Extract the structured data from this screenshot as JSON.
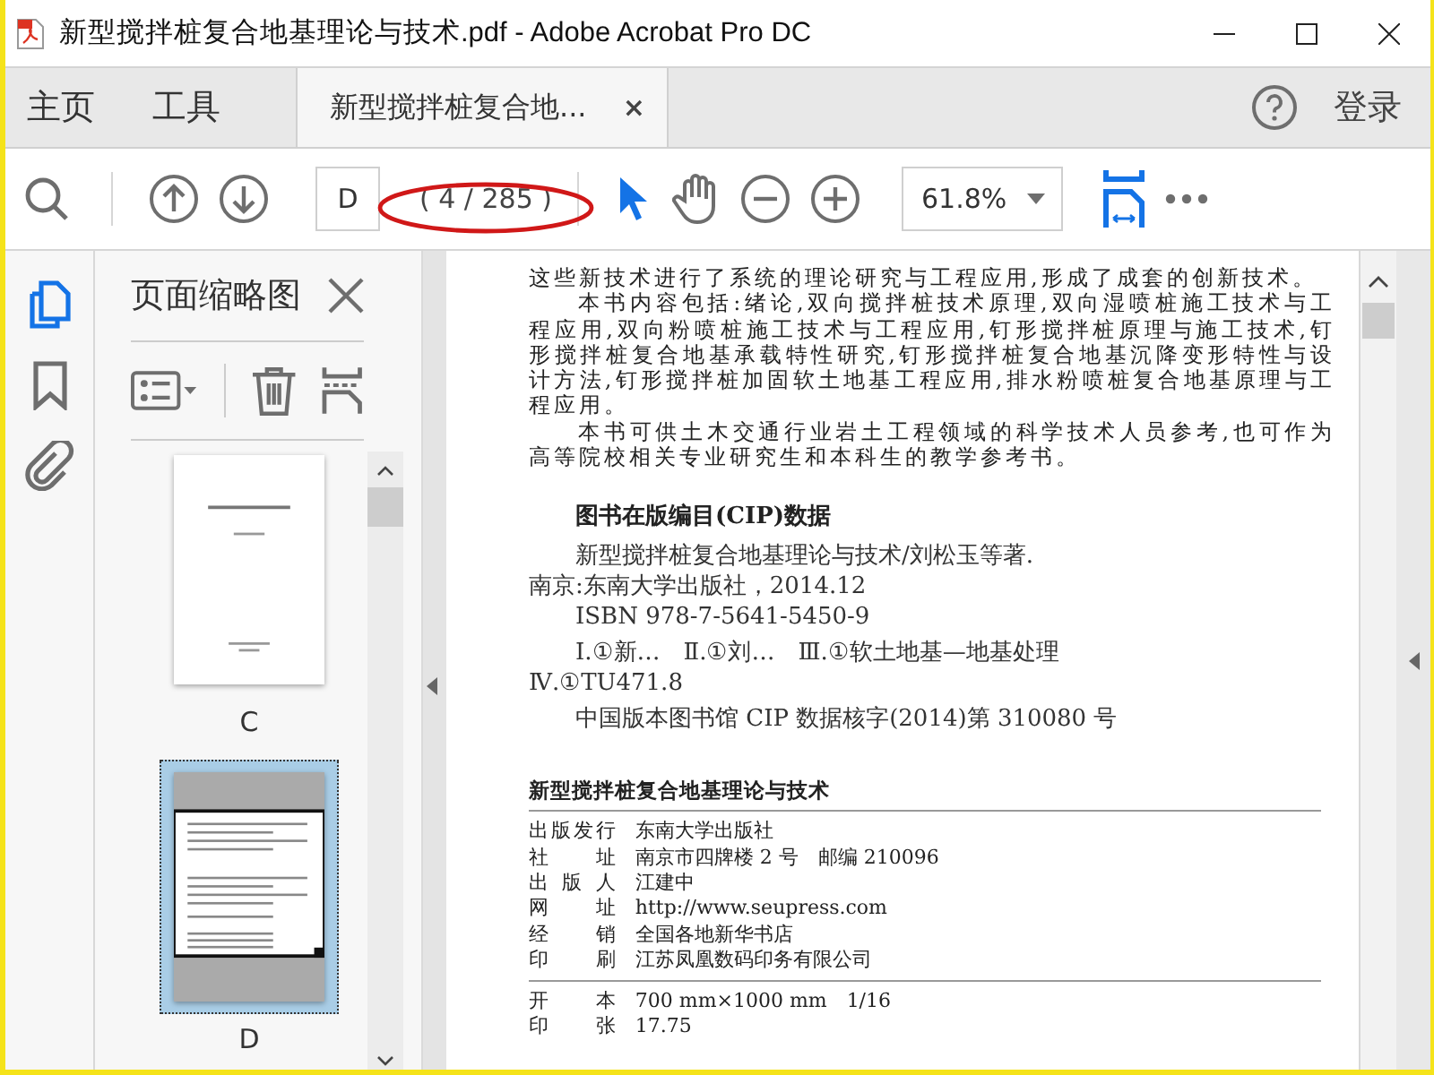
{
  "window": {
    "title": "新型搅拌桩复合地基理论与技术.pdf - Adobe Acrobat Pro DC"
  },
  "nav_tabs": [
    {
      "label": "主页",
      "selected": false
    },
    {
      "label": "工具",
      "selected": false
    }
  ],
  "document_tab": {
    "label": "新型搅拌桩复合地...",
    "close": "×",
    "selected": true
  },
  "sign_in": "登录",
  "toolbar": {
    "page_label": "D",
    "page_count": "( 4 / 285 )",
    "zoom": "61.8%",
    "tools": [
      {
        "kind": "select",
        "selected": true
      },
      {
        "kind": "hand",
        "selected": false
      }
    ]
  },
  "side_panels": [
    {
      "kind": "pages",
      "selected": true
    },
    {
      "kind": "bookmarks",
      "selected": false
    },
    {
      "kind": "attachments",
      "selected": false
    }
  ],
  "thumbnail_panel": {
    "title": "页面缩略图"
  },
  "thumbnails": [
    {
      "label": "C",
      "selected": false
    },
    {
      "label": "D",
      "selected": true
    }
  ],
  "page": {
    "paragraphs": [
      {
        "indent": false,
        "text": "这些新技术进行了系统的理论研究与工程应用,形成了成套的创新技术。"
      },
      {
        "indent": true,
        "text": "本书内容包括:绪论,双向搅拌桩技术原理,双向湿喷桩施工技术与工程应用,双向粉喷桩施工技术与工程应用,钉形搅拌桩原理与施工技术,钉形搅拌桩复合地基承载特性研究,钉形搅拌桩复合地基沉降变形特性与设计方法,钉形搅拌桩加固软土地基工程应用,排水粉喷桩复合地基原理与工程应用。"
      },
      {
        "indent": true,
        "text": "本书可供土木交通行业岩土工程领域的科学技术人员参考,也可作为高等院校相关专业研究生和本科生的教学参考书。"
      }
    ],
    "cip": {
      "heading": "图书在版编目(CIP)数据",
      "blocks": [
        {
          "lines": [
            {
              "indent": true,
              "text": "新型搅拌桩复合地基理论与技术/刘松玉等著."
            },
            {
              "indent": false,
              "text": "南京:东南大学出版社，2014.12"
            },
            {
              "indent": true,
              "text": "ISBN 978-7-5641-5450-9"
            }
          ]
        },
        {
          "lines": [
            {
              "indent": true,
              "text": "Ⅰ.①新…　Ⅱ.①刘…　Ⅲ.①软土地基—地基处理"
            },
            {
              "indent": false,
              "text": "Ⅳ.①TU471.8"
            }
          ]
        },
        {
          "lines": [
            {
              "indent": true,
              "text": "中国版本图书馆 CIP 数据核字(2014)第 310080 号"
            }
          ]
        }
      ]
    },
    "colophon": {
      "title": "新型搅拌桩复合地基理论与技术",
      "rows": [
        {
          "label": "出版发行",
          "value": "东南大学出版社"
        },
        {
          "label": "社 址",
          "value": "南京市四牌楼 2 号　邮编 210096"
        },
        {
          "label": "出 版 人",
          "value": "江建中"
        },
        {
          "label": "网 址",
          "value": "http://www.seupress.com"
        },
        {
          "label": "经 销",
          "value": "全国各地新华书店"
        },
        {
          "label": "印 刷",
          "value": "江苏凤凰数码印务有限公司"
        }
      ],
      "specs": [
        {
          "label": "开 本",
          "value": "700 mm×1000 mm　1/16"
        },
        {
          "label": "印 张",
          "value": "17.75"
        }
      ]
    }
  }
}
